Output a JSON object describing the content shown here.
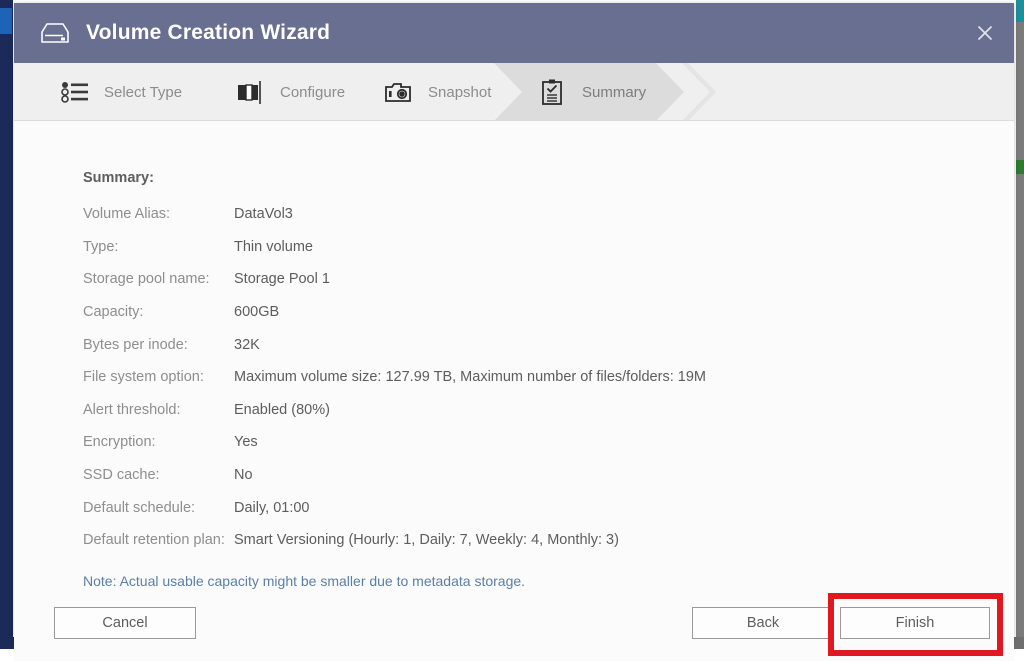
{
  "window": {
    "title": "Volume Creation Wizard",
    "title_icon": "disk-drive-icon",
    "close_icon": "close-icon",
    "header_color": "#686f90"
  },
  "steps": [
    {
      "label": "Select Type",
      "icon": "list-bullet-icon",
      "active": false
    },
    {
      "label": "Configure",
      "icon": "volume-blocks-icon",
      "active": false
    },
    {
      "label": "Snapshot",
      "icon": "camera-icon",
      "active": false
    },
    {
      "label": "Summary",
      "icon": "clipboard-check-icon",
      "active": true
    }
  ],
  "summary": {
    "heading": "Summary:",
    "rows": [
      {
        "label": "Volume Alias:",
        "value": "DataVol3"
      },
      {
        "label": "Type:",
        "value": "Thin volume"
      },
      {
        "label": "Storage pool name:",
        "value": "Storage Pool 1"
      },
      {
        "label": "Capacity:",
        "value": "600GB"
      },
      {
        "label": "Bytes per inode:",
        "value": "32K"
      },
      {
        "label": "File system option:",
        "value": "Maximum volume size: 127.99 TB, Maximum number of files/folders: 19M"
      },
      {
        "label": "Alert threshold:",
        "value": "Enabled (80%)"
      },
      {
        "label": "Encryption:",
        "value": "Yes"
      },
      {
        "label": "SSD cache:",
        "value": "No"
      },
      {
        "label": "Default schedule:",
        "value": "Daily, 01:00"
      },
      {
        "label": "Default retention plan:",
        "value": "Smart Versioning (Hourly: 1, Daily: 7, Weekly: 4, Monthly: 3)"
      }
    ],
    "note": "Note: Actual usable capacity might be smaller due to metadata storage.",
    "note_color": "#5b7fa6"
  },
  "footer": {
    "cancel_label": "Cancel",
    "back_label": "Back",
    "finish_label": "Finish",
    "highlight_color": "#e0181f"
  }
}
